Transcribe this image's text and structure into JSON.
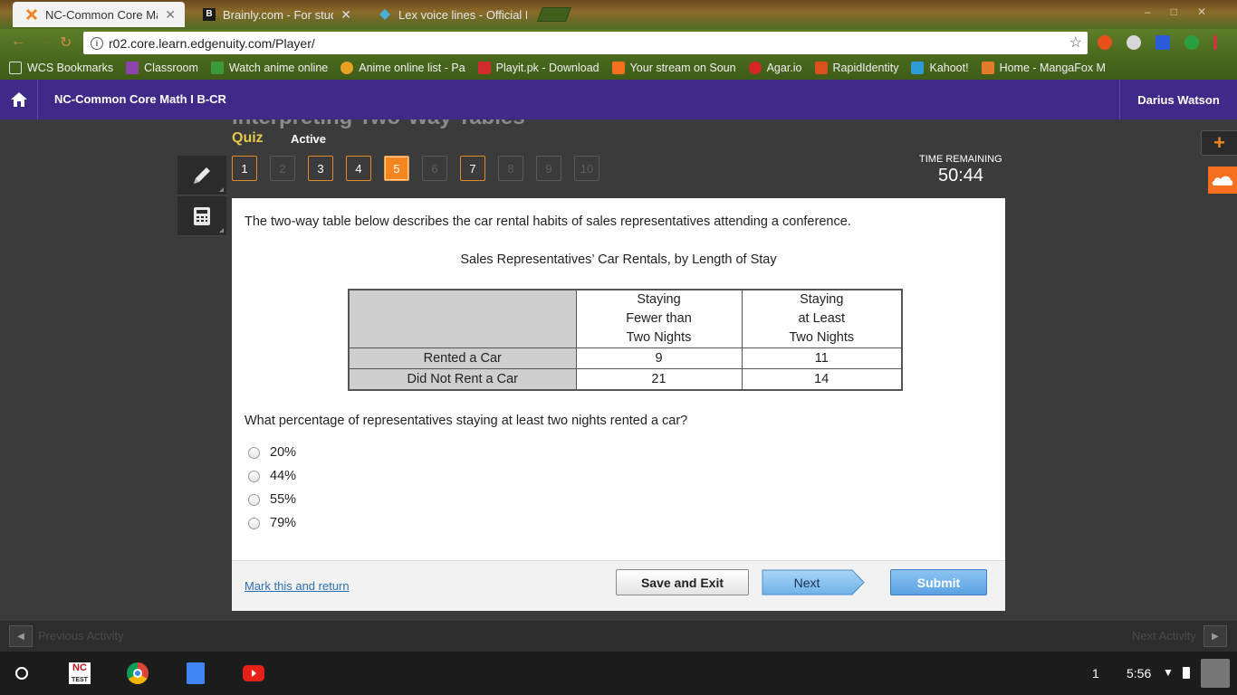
{
  "browser": {
    "tabs": [
      {
        "title": "NC-Common Core Math",
        "active": true,
        "favicon": "edgenuity-x-icon"
      },
      {
        "title": "Brainly.com - For studen",
        "active": false,
        "favicon": "brainly-b-icon"
      },
      {
        "title": "Lex voice lines - Official F",
        "active": false,
        "favicon": "diamond-icon"
      }
    ],
    "url": "r02.core.learn.edgenuity.com/Player/",
    "bookmarks": [
      {
        "label": "WCS Bookmarks",
        "icon": "folder-icon",
        "color": "#cfcfcf"
      },
      {
        "label": "Classroom",
        "icon": "classroom-icon",
        "color": "#8e44ad"
      },
      {
        "label": "Watch anime online",
        "icon": "tv-icon",
        "color": "#3a9a3a"
      },
      {
        "label": "Anime online list - Pa",
        "icon": "chrome-ball-icon",
        "color": "#e8a020"
      },
      {
        "label": "Playit.pk - Download",
        "icon": "pi-icon",
        "color": "#d12b2b"
      },
      {
        "label": "Your stream on Soun",
        "icon": "soundcloud-icon",
        "color": "#f5701f"
      },
      {
        "label": "Agar.io",
        "icon": "agar-icon",
        "color": "#d42424"
      },
      {
        "label": "RapidIdentity",
        "icon": "rapid-icon",
        "color": "#d8501a"
      },
      {
        "label": "Kahoot!",
        "icon": "kahoot-icon",
        "color": "#2d9bd6"
      },
      {
        "label": "Home - MangaFox M",
        "icon": "mangafox-icon",
        "color": "#e47b2a"
      }
    ]
  },
  "app": {
    "course_title": "NC-Common Core Math I B-CR",
    "user_name": "Darius Watson",
    "lesson_title": "Interpreting Two-Way Tables",
    "quiz_label": "Quiz",
    "quiz_status": "Active",
    "question_numbers": [
      {
        "n": "1",
        "state": "answered"
      },
      {
        "n": "2",
        "state": "disabled"
      },
      {
        "n": "3",
        "state": "answered"
      },
      {
        "n": "4",
        "state": "answered"
      },
      {
        "n": "5",
        "state": "current"
      },
      {
        "n": "6",
        "state": "disabled"
      },
      {
        "n": "7",
        "state": "answered"
      },
      {
        "n": "8",
        "state": "disabled"
      },
      {
        "n": "9",
        "state": "disabled"
      },
      {
        "n": "10",
        "state": "disabled"
      }
    ],
    "timer": {
      "label": "TIME REMAINING",
      "value": "50:44"
    }
  },
  "question": {
    "prompt": "The two-way table below describes the car rental habits of sales representatives attending a conference.",
    "table_title": "Sales Representatives’ Car Rentals, by Length of Stay",
    "table": {
      "col_headers": [
        [
          "Staying",
          "Fewer than",
          "Two Nights"
        ],
        [
          "Staying",
          "at Least",
          "Two Nights"
        ]
      ],
      "rows": [
        {
          "label": "Rented a Car",
          "values": [
            "9",
            "11"
          ]
        },
        {
          "label": "Did Not Rent a Car",
          "values": [
            "21",
            "14"
          ]
        }
      ]
    },
    "text": "What percentage of representatives staying at least two nights rented a car?",
    "options": [
      "20%",
      "44%",
      "55%",
      "79%"
    ]
  },
  "footer": {
    "mark_link": "Mark this and return",
    "save_label": "Save and Exit",
    "next_label": "Next",
    "submit_label": "Submit"
  },
  "activity_bar": {
    "prev_label": "Previous Activity",
    "next_label": "Next Activity"
  },
  "shelf": {
    "notification_count": "1",
    "time": "5:56",
    "apps": [
      "nc-test-icon",
      "chrome-icon",
      "docs-icon",
      "youtube-icon"
    ]
  },
  "colors": {
    "app_header": "#3f2a8a",
    "accent_orange": "#f5861f",
    "quiz_yellow": "#e6c84a",
    "submit_blue": "#5ba2e2"
  }
}
